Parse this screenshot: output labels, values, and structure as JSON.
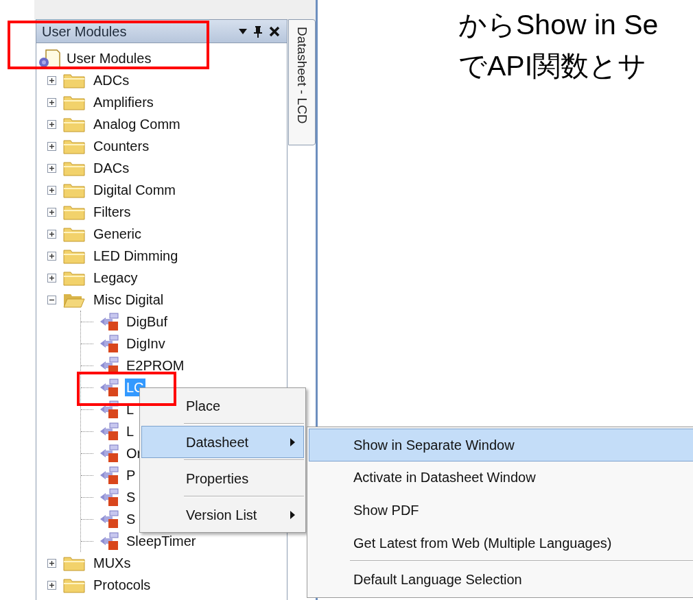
{
  "slide_text": [
    "からShow in Se",
    "でAPI関数とサ"
  ],
  "panel": {
    "title": "User Modules",
    "side_tab": "Datasheet - LCD",
    "tree": {
      "label": "User Modules",
      "kind": "root",
      "selected": false,
      "children": [
        {
          "label": "ADCs",
          "kind": "folder",
          "expanded": false,
          "selected": false
        },
        {
          "label": "Amplifiers",
          "kind": "folder",
          "expanded": false,
          "selected": false
        },
        {
          "label": "Analog Comm",
          "kind": "folder",
          "expanded": false,
          "selected": false
        },
        {
          "label": "Counters",
          "kind": "folder",
          "expanded": false,
          "selected": false
        },
        {
          "label": "DACs",
          "kind": "folder",
          "expanded": false,
          "selected": false
        },
        {
          "label": "Digital Comm",
          "kind": "folder",
          "expanded": false,
          "selected": false
        },
        {
          "label": "Filters",
          "kind": "folder",
          "expanded": false,
          "selected": false
        },
        {
          "label": "Generic",
          "kind": "folder",
          "expanded": false,
          "selected": false
        },
        {
          "label": "LED Dimming",
          "kind": "folder",
          "expanded": false,
          "selected": false
        },
        {
          "label": "Legacy",
          "kind": "folder",
          "expanded": false,
          "selected": false
        },
        {
          "label": "Misc Digital",
          "kind": "folder",
          "expanded": true,
          "selected": false,
          "children": [
            {
              "label": "DigBuf",
              "kind": "module",
              "selected": false
            },
            {
              "label": "DigInv",
              "kind": "module",
              "selected": false
            },
            {
              "label": "E2PROM",
              "kind": "module",
              "selected": false
            },
            {
              "label": "LC",
              "kind": "module",
              "selected": true
            },
            {
              "label": "L",
              "kind": "module",
              "selected": false
            },
            {
              "label": "L",
              "kind": "module",
              "selected": false
            },
            {
              "label": "Or",
              "kind": "module",
              "selected": false
            },
            {
              "label": "P",
              "kind": "module",
              "selected": false
            },
            {
              "label": "S",
              "kind": "module",
              "selected": false
            },
            {
              "label": "S",
              "kind": "module",
              "selected": false
            },
            {
              "label": "SleepTimer",
              "kind": "module",
              "selected": false
            }
          ]
        },
        {
          "label": "MUXs",
          "kind": "folder",
          "expanded": false,
          "selected": false
        },
        {
          "label": "Protocols",
          "kind": "folder",
          "expanded": false,
          "selected": false
        }
      ]
    }
  },
  "context_menu": {
    "items": [
      {
        "kind": "item",
        "label": "Place",
        "selected": false,
        "has_submenu": false
      },
      {
        "kind": "separator"
      },
      {
        "kind": "item",
        "label": "Datasheet",
        "selected": true,
        "has_submenu": true
      },
      {
        "kind": "separator"
      },
      {
        "kind": "item",
        "label": "Properties",
        "selected": false,
        "has_submenu": false
      },
      {
        "kind": "separator"
      },
      {
        "kind": "item",
        "label": "Version List",
        "selected": false,
        "has_submenu": true
      }
    ]
  },
  "submenu": {
    "items": [
      {
        "kind": "item",
        "label": "Show in Separate Window",
        "selected": true
      },
      {
        "kind": "item",
        "label": "Activate in Datasheet Window",
        "selected": false
      },
      {
        "kind": "item",
        "label": "Show PDF",
        "selected": false
      },
      {
        "kind": "item",
        "label": "Get Latest from Web (Multiple Languages)",
        "selected": false
      },
      {
        "kind": "separator"
      },
      {
        "kind": "item",
        "label": "Default Language Selection",
        "selected": false
      }
    ]
  }
}
